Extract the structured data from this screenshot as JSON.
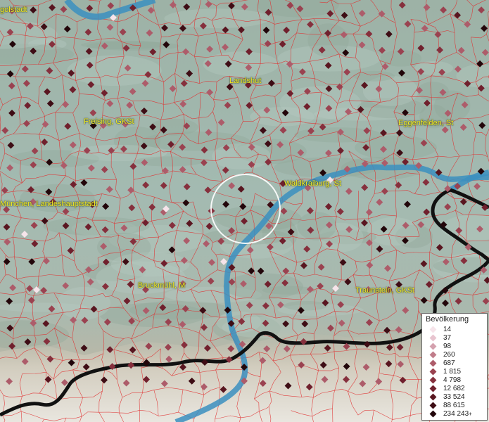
{
  "map": {
    "cities": [
      {
        "name": "golstadt"
      },
      {
        "name": "Landshut"
      },
      {
        "name": "Freising, GKSt"
      },
      {
        "name": "Eggenfelden, St"
      },
      {
        "name": "Waldkraiburg, St"
      },
      {
        "name": "München, Landeshauptstadt"
      },
      {
        "name": "Bruckmühl, M"
      },
      {
        "name": "Traunstein, GKSt"
      }
    ],
    "colors": {
      "terrain": "#9fb5ab",
      "boundary": "#e03030",
      "river": "#3b8fbf",
      "state_border": "#111111",
      "label": "#f2ea2a",
      "selection_circle": "#ffffff"
    }
  },
  "legend": {
    "title": "Bevölkerung",
    "items": [
      {
        "label": "14",
        "color": "#f6e4ea"
      },
      {
        "label": "37",
        "color": "#e8c4cf"
      },
      {
        "label": "98",
        "color": "#d4a1ae"
      },
      {
        "label": "260",
        "color": "#c07c8a"
      },
      {
        "label": "687",
        "color": "#ad5c6a"
      },
      {
        "label": "1 815",
        "color": "#9a4250"
      },
      {
        "label": "4 798",
        "color": "#86303d"
      },
      {
        "label": "12 682",
        "color": "#70202d"
      },
      {
        "label": "33 524",
        "color": "#591620"
      },
      {
        "label": "88 615",
        "color": "#3e0d15"
      },
      {
        "label": "234 243",
        "color": "#22060a"
      }
    ],
    "open_end_marker": "+"
  }
}
